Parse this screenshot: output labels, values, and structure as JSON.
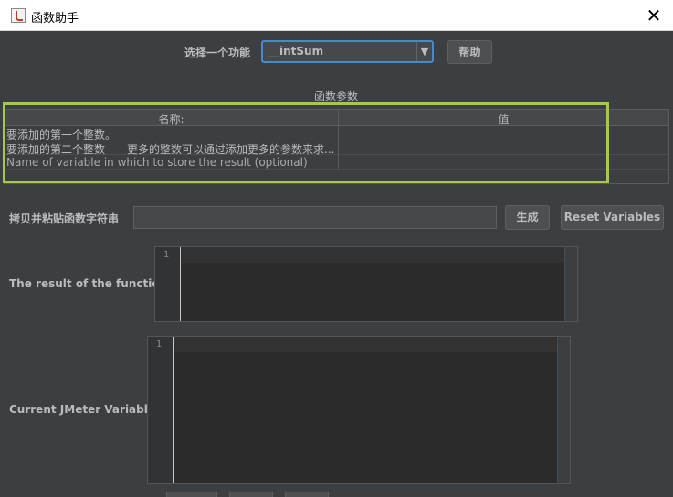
{
  "window": {
    "title": "函数助手",
    "close_glyph": "✕"
  },
  "function_selector": {
    "label": "选择一个功能",
    "selected": "__intSum",
    "arrow_glyph": "▼",
    "help_label": "帮助"
  },
  "params": {
    "title": "函数参数",
    "columns": [
      "名称:",
      "值"
    ],
    "rows": [
      {
        "name": "要添加的第一个整数。",
        "value": ""
      },
      {
        "name": "要添加的第二个整数——更多的整数可以通过添加更多的参数来求...",
        "value": ""
      },
      {
        "name": "Name of variable in which to store the result (optional)",
        "value": ""
      }
    ],
    "highlight_color": "#a6c84f"
  },
  "copy_row": {
    "label": "拷贝并粘贴函数字符串",
    "value": "",
    "generate_label": "生成",
    "reset_label": "Reset Variables"
  },
  "result": {
    "label": "The result of the function is",
    "line_number": "1"
  },
  "variables": {
    "label": "Current JMeter Variables",
    "line_number": "1"
  },
  "colors": {
    "background": "#3c3f41",
    "editor_bg": "#2b2b2b",
    "accent_focus": "#4a88c7"
  }
}
